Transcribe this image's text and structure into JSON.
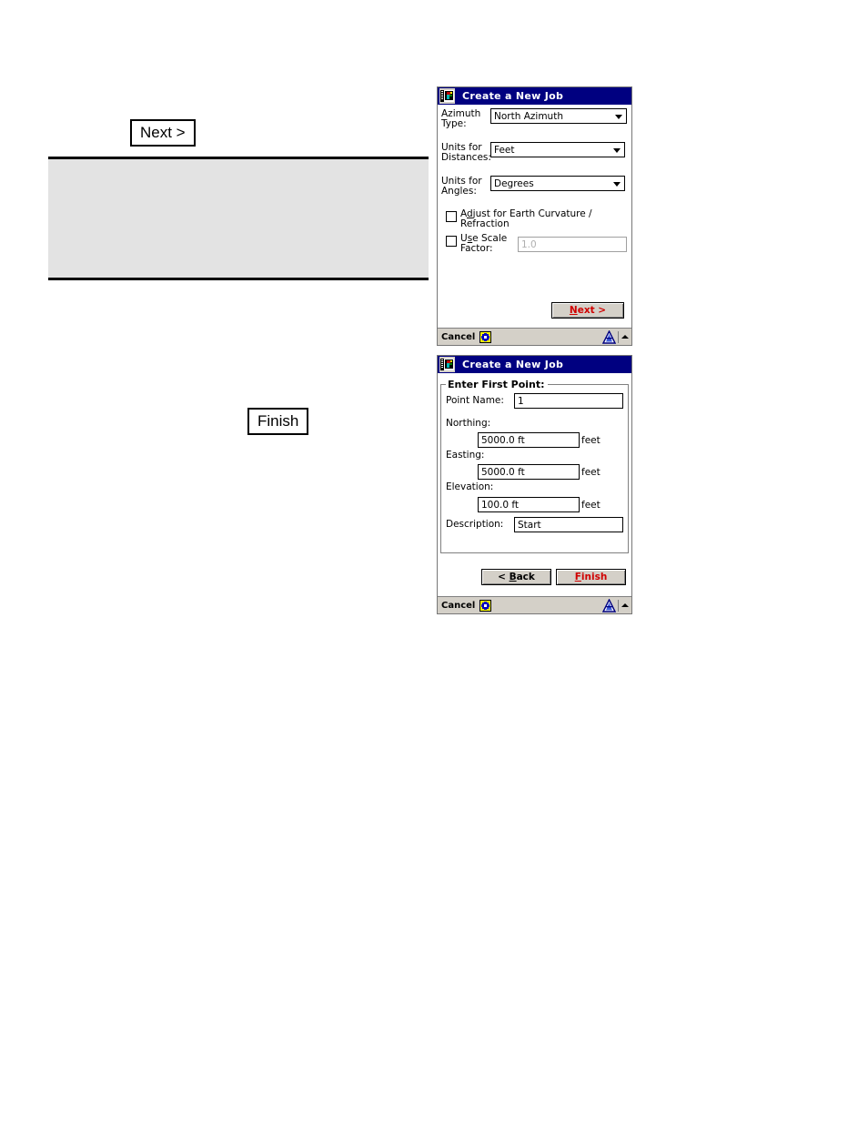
{
  "page": {
    "reference_labels": [
      {
        "id": "next",
        "text": "Next >"
      },
      {
        "id": "finish",
        "text": "Finish"
      }
    ],
    "gray_block_text": ""
  },
  "dialog_one": {
    "title": "Create a New Job",
    "title_icon": "surveying-instrument-icon",
    "fields": [
      {
        "label": "Azimuth\nType:",
        "control": "combobox",
        "value": "North Azimuth",
        "options": [
          "North Azimuth"
        ]
      },
      {
        "label": "Units for\nDistances:",
        "control": "combobox",
        "value": "Feet",
        "options": [
          "Feet"
        ]
      },
      {
        "label": "Units for\nAngles:",
        "control": "combobox",
        "value": "Degrees",
        "options": [
          "Degrees"
        ]
      }
    ],
    "checkboxes": [
      {
        "label_before": "A",
        "label_accel": "d",
        "label_after": "just for Earth Curvature /\nRefraction",
        "label_plain": "Adjust for Earth Curvature /\nRefraction",
        "checked": false
      },
      {
        "label_before": "U",
        "label_accel": "s",
        "label_after": "e Scale\nFactor:",
        "label_plain": "Use Scale\nFactor:",
        "checked": false
      }
    ],
    "scale_factor_field": {
      "value": "1.0",
      "enabled": false
    },
    "next_button": {
      "accel": "N",
      "rest": "ext >",
      "full": "Next >",
      "color": "#d00000"
    },
    "statusbar": {
      "cancel_label": "Cancel",
      "star_icon": "new-star-icon",
      "sip_icon": "input-panel-icon",
      "arrow_icon": "chevron-up-icon"
    }
  },
  "dialog_two": {
    "title": "Create a New Job",
    "title_icon": "surveying-instrument-icon",
    "group_caption": "Enter First Point:",
    "fields": [
      {
        "label": "Point Name:",
        "value": "1",
        "suffix": ""
      },
      {
        "label": "Northing:",
        "value": "5000.0 ft",
        "suffix": "feet"
      },
      {
        "label": "Easting:",
        "value": "5000.0 ft",
        "suffix": "feet"
      },
      {
        "label": "Elevation:",
        "value": "100.0 ft",
        "suffix": "feet"
      },
      {
        "label": "Description:",
        "value": "Start",
        "suffix": ""
      }
    ],
    "back_button": {
      "prefix": "< ",
      "accel": "B",
      "rest": "ack",
      "full": "< Back",
      "color": "#000000"
    },
    "finish_button": {
      "accel": "F",
      "rest": "inish",
      "full": "Finish",
      "color": "#d00000"
    },
    "statusbar": {
      "cancel_label": "Cancel",
      "star_icon": "new-star-icon",
      "sip_icon": "input-panel-icon",
      "arrow_icon": "chevron-up-icon"
    }
  }
}
